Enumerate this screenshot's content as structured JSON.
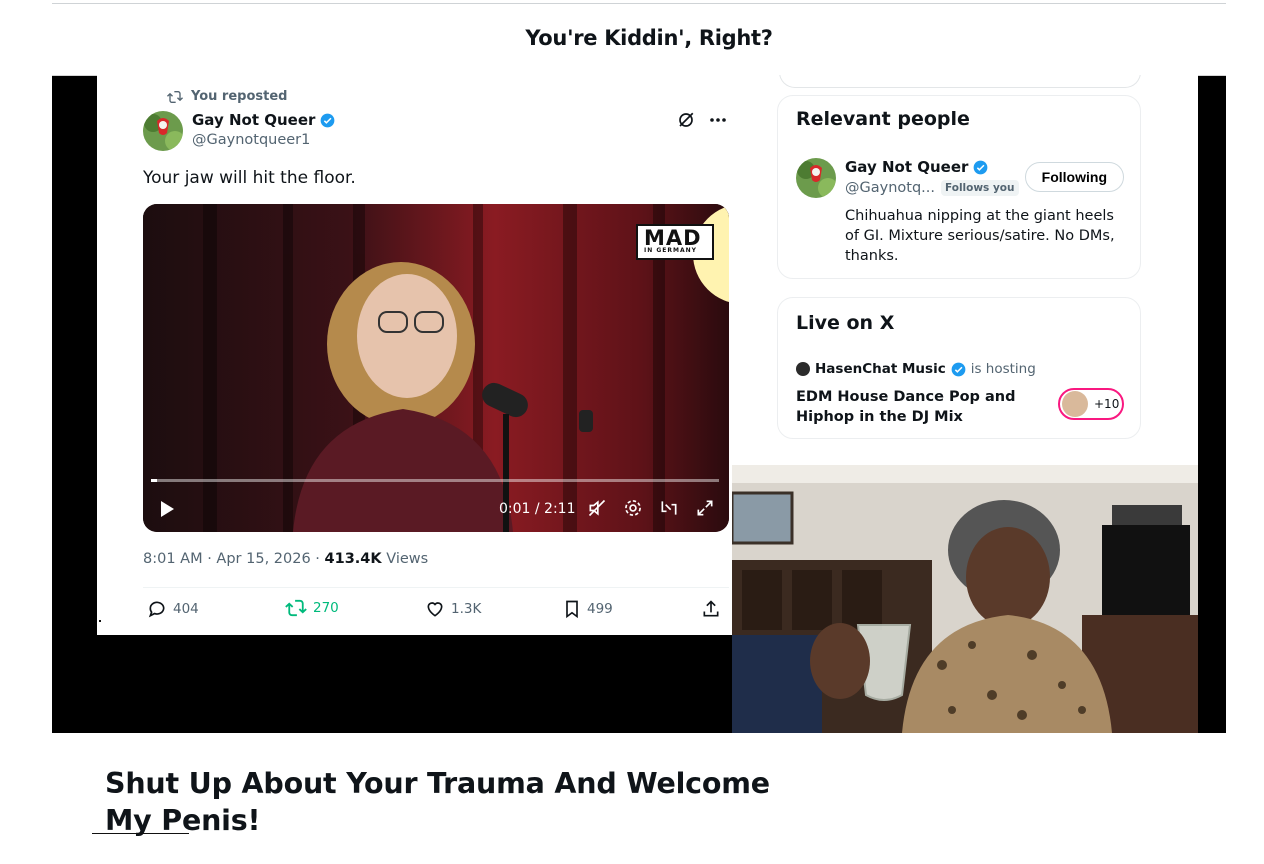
{
  "page": {
    "title": "You're Kiddin', Right?",
    "headline": "Shut Up About Your Trauma And Welcome My Penis!"
  },
  "tweet": {
    "repost_label": "You reposted",
    "author_name": "Gay Not Queer",
    "author_handle": "@Gaynotqueer1",
    "text": "Your jaw will hit the floor.",
    "video": {
      "logo_text": "MAD",
      "logo_subtext": "IN GERMANY",
      "time": "0:01 / 2:11",
      "progress": 0.01
    },
    "timestamp": "8:01 AM · Apr 15, 2026 · ",
    "views_count": "413.4K",
    "views_label": " Views",
    "stats": {
      "replies": "404",
      "reposts": "270",
      "likes": "1.3K",
      "bookmarks": "499"
    }
  },
  "relevant_people": {
    "title": "Relevant people",
    "name": "Gay Not Queer",
    "handle": "@Gaynotq...",
    "follows_you": "Follows you",
    "button": "Following",
    "bio": "Chihuahua nipping at the giant heels of GI. Mixture serious/satire. No DMs, thanks."
  },
  "live": {
    "title": "Live on X",
    "host": "HasenChat Music",
    "hosting_label": "is hosting",
    "stream_title": "EDM House Dance Pop and Hiphop in the DJ Mix",
    "listeners": "+10"
  },
  "colors": {
    "verified": "#1d9bf0",
    "repost_active": "#00ba7c",
    "live_ring": "#f91880",
    "text_secondary": "#536471"
  }
}
